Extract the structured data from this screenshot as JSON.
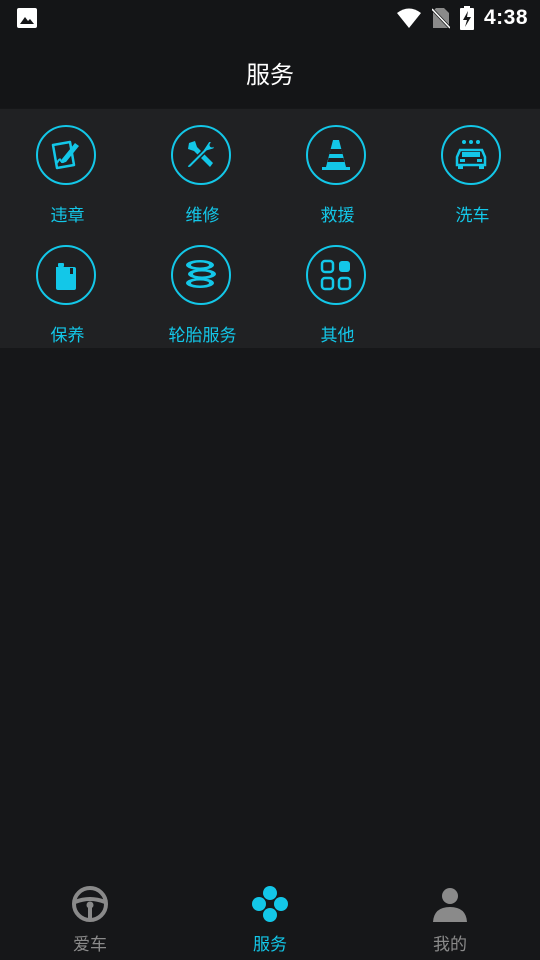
{
  "status_bar": {
    "time": "4:38",
    "icons": [
      "image-icon",
      "wifi-icon",
      "no-sim-icon",
      "battery-charging-icon"
    ]
  },
  "header": {
    "title": "服务"
  },
  "services": [
    {
      "label": "违章",
      "icon": "violation-icon"
    },
    {
      "label": "维修",
      "icon": "repair-tools-icon"
    },
    {
      "label": "救援",
      "icon": "traffic-cone-icon"
    },
    {
      "label": "洗车",
      "icon": "car-wash-icon"
    },
    {
      "label": "保养",
      "icon": "oil-can-icon"
    },
    {
      "label": "轮胎服务",
      "icon": "tires-icon"
    },
    {
      "label": "其他",
      "icon": "grid-apps-icon"
    }
  ],
  "tabs": [
    {
      "label": "爱车",
      "icon": "steering-wheel-icon",
      "active": false
    },
    {
      "label": "服务",
      "icon": "clover-icon",
      "active": true
    },
    {
      "label": "我的",
      "icon": "person-icon",
      "active": false
    }
  ],
  "colors": {
    "accent": "#13c7e8",
    "inactive": "#8a8a8a",
    "background": "#161719",
    "panel": "#202123"
  }
}
